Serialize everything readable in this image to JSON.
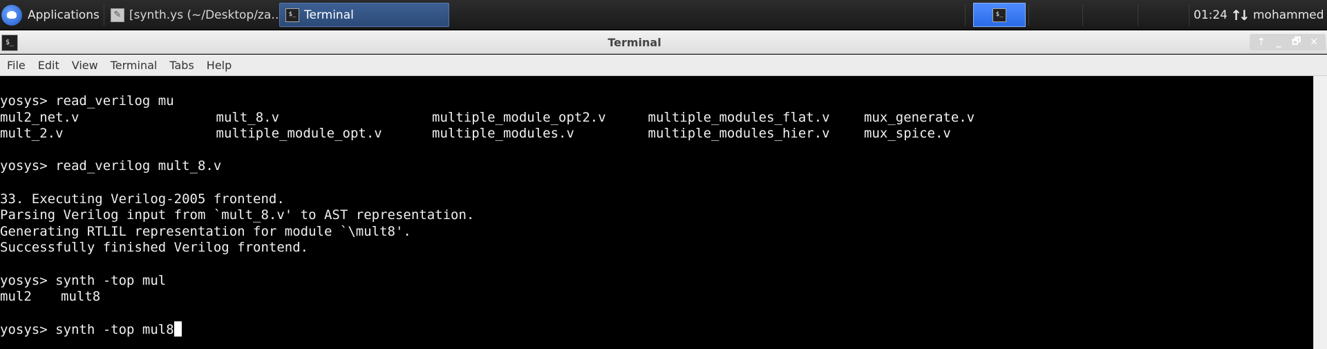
{
  "panel": {
    "applications_label": "Applications",
    "tasks": [
      {
        "label": "[synth.ys (~/Desktop/za…",
        "icon": "edit-icon"
      },
      {
        "label": "Terminal",
        "icon": "terminal-icon"
      }
    ],
    "clock": "01:24",
    "user": "mohammed"
  },
  "window": {
    "title": "Terminal",
    "menu": [
      "File",
      "Edit",
      "View",
      "Terminal",
      "Tabs",
      "Help"
    ],
    "buttons": [
      "⇡",
      "_",
      "🗗",
      "✕"
    ]
  },
  "terminal": {
    "lines": [
      "yosys> read_verilog mu",
      "",
      "",
      "",
      "yosys> read_verilog mult_8.v",
      "",
      "33. Executing Verilog-2005 frontend.",
      "Parsing Verilog input from `mult_8.v' to AST representation.",
      "Generating RTLIL representation for module `\\mult8'.",
      "Successfully finished Verilog frontend.",
      "",
      "yosys> synth -top mul",
      "",
      "",
      "yosys> synth -top mul8"
    ],
    "completions1": [
      [
        "mul2_net.v",
        "mult_8.v",
        "multiple_module_opt2.v",
        "multiple_modules_flat.v",
        "mux_generate.v"
      ],
      [
        "mult_2.v",
        "multiple_module_opt.v",
        "multiple_modules.v",
        "multiple_modules_hier.v",
        "mux_spice.v"
      ]
    ],
    "completions2": [
      "mul2",
      "mult8"
    ]
  },
  "colors": {
    "panel_bg": "#1f1f1f",
    "active_task": "#2f5286",
    "workspace": "#3a7bf2",
    "terminal_bg": "#000000",
    "terminal_fg": "#f0f0f0"
  }
}
